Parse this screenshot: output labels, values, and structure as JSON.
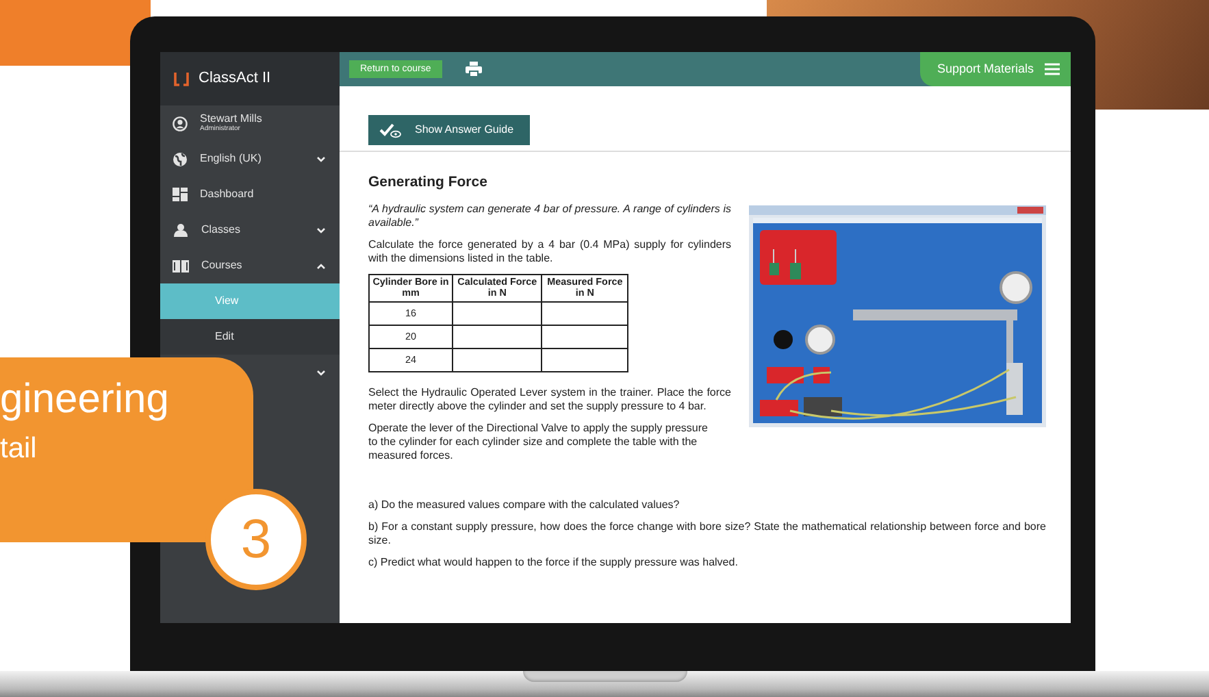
{
  "app": {
    "logo_text": "ClassAct II"
  },
  "sidebar": {
    "user": {
      "name": "Stewart Mills",
      "role": "Administrator"
    },
    "items": [
      {
        "kind": "globe",
        "label": "English (UK)",
        "expanded": false
      },
      {
        "kind": "dashboard",
        "label": "Dashboard"
      },
      {
        "kind": "people",
        "label": "Classes",
        "expanded": false
      },
      {
        "kind": "book",
        "label": "Courses",
        "expanded": true,
        "children": [
          {
            "label": "View",
            "selected": true
          },
          {
            "label": "Edit",
            "selected": false
          }
        ]
      },
      {
        "kind": "hidden",
        "expanded": false
      }
    ]
  },
  "topbar": {
    "return_button": "Return to course",
    "support_label": "Support Materials"
  },
  "answer_button": "Show Answer Guide",
  "exercise": {
    "title": "Generating Force",
    "quote": "“A hydraulic system can generate 4 bar of pressure. A range of cylinders is available.”",
    "instruction": "Calculate the force generated by a 4 bar (0.4 MPa) supply for cylinders with the dimensions listed in the table.",
    "table": {
      "columns": [
        "Cylinder Bore in mm",
        "Calculated Force in N",
        "Measured Force in N"
      ],
      "rows": [
        [
          "16",
          "",
          ""
        ],
        [
          "20",
          "",
          ""
        ],
        [
          "24",
          "",
          ""
        ]
      ]
    },
    "steps": [
      "Select the Hydraulic Operated Lever system in the trainer. Place the force meter directly above the cylinder and set the supply pressure to 4 bar.",
      "Operate the lever of the Directional Valve to apply the supply pressure\nto the cylinder for each cylinder size and complete the table with the measured forces."
    ],
    "questions": [
      "a) Do the measured values compare with the calculated values?",
      "b) For a constant supply pressure, how does the force change with bore size? State the mathematical relationship between force and bore size.",
      "c) Predict what would happen to the force if the supply pressure was halved."
    ]
  },
  "overlay": {
    "title": "gineering",
    "subtitle": "tail",
    "number": "3"
  }
}
